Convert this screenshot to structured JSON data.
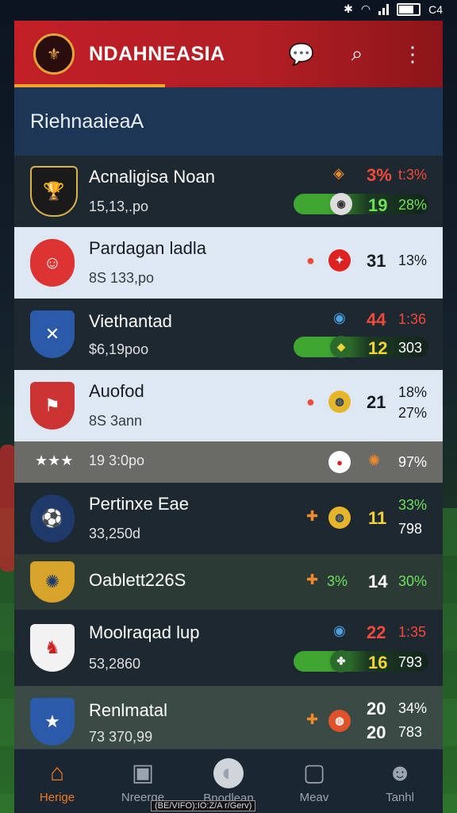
{
  "status": {
    "right_text": "C4"
  },
  "header": {
    "title": "NDAHNEASIA",
    "logo_icon": "crest-logo",
    "actions": [
      {
        "icon": "chat-icon"
      },
      {
        "icon": "search-icon"
      },
      {
        "icon": "more-vert-icon"
      }
    ]
  },
  "section": {
    "title": "RiehnaaieaA"
  },
  "rows": [
    {
      "name": "Acnaligisa Noan",
      "sub": "15,13,.po",
      "score_top": "3%",
      "pct_top": "t:3%",
      "score_bottom": "19",
      "pct_bottom": "28%"
    },
    {
      "name": "Pardagan ladla",
      "sub": "8S 133,po",
      "score": "31",
      "pct": "13%"
    },
    {
      "name": "Viethantad",
      "sub": "$6,19poo",
      "score_top": "44",
      "pct_top": "1:36",
      "score_bottom": "12",
      "pct_bottom": "303"
    },
    {
      "name": "Auofod",
      "sub": "8S 3ann",
      "score": "21",
      "pct_top": "18%",
      "pct_bottom": "27%"
    },
    {
      "stars": "★★★",
      "sub": "19 3:0po",
      "pct": "97%"
    },
    {
      "name": "Pertinxe Eae",
      "sub": "33,250d",
      "score": "11",
      "pct_top": "33%",
      "pct_bottom": "798"
    },
    {
      "name": "Oablett226S",
      "mid": "3%",
      "score": "14",
      "pct": "30%"
    },
    {
      "name": "Moolraqad lup",
      "sub": "53,2860",
      "score_top": "22",
      "pct_top": "1:35",
      "score_bottom": "16",
      "pct_bottom": "793"
    },
    {
      "name": "Renlmatal",
      "sub": "73 370,99",
      "score_top": "20",
      "pct_top": "34%",
      "score_bottom": "20",
      "pct_bottom": "783"
    }
  ],
  "nav": [
    {
      "label": "Herige",
      "icon": "home-icon"
    },
    {
      "label": "Nreerge",
      "icon": "schedule-icon"
    },
    {
      "label": "Bnodlean",
      "icon": "ball-icon"
    },
    {
      "label": "Meav",
      "icon": "tv-icon"
    },
    {
      "label": "Tanhl",
      "icon": "profile-icon"
    }
  ],
  "footer_caption": "(BE/VIFO):IO:Z/A r/Gerv)"
}
